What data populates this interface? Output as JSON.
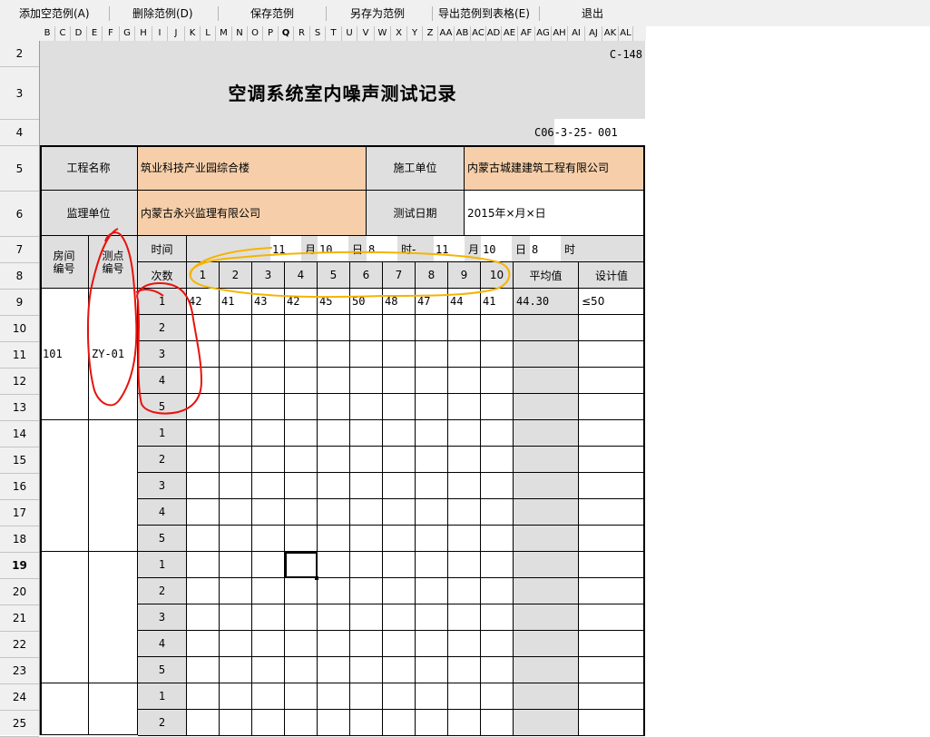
{
  "toolbar": {
    "add_empty": "添加空范例(A)",
    "delete": "删除范例(D)",
    "save": "保存范例",
    "save_as": "另存为范例",
    "export": "导出范例到表格(E)",
    "exit": "退出"
  },
  "columns": [
    "B",
    "C",
    "D",
    "E",
    "F",
    "G",
    "H",
    "I",
    "J",
    "K",
    "L",
    "M",
    "N",
    "O",
    "P",
    "Q",
    "R",
    "S",
    "T",
    "U",
    "V",
    "W",
    "X",
    "Y",
    "Z",
    "AA",
    "AB",
    "AC",
    "AD",
    "AE",
    "AF",
    "AG",
    "AH",
    "AI",
    "AJ",
    "AK",
    "AL"
  ],
  "selected_column": "Q",
  "rows": [
    "2",
    "3",
    "4",
    "5",
    "6",
    "7",
    "8",
    "9",
    "10",
    "11",
    "12",
    "13",
    "14",
    "15",
    "16",
    "17",
    "18",
    "19",
    "20",
    "21",
    "22",
    "23",
    "24",
    "25"
  ],
  "selected_row": "19",
  "form": {
    "code": "C-148",
    "title": "空调系统室内噪声测试记录",
    "record_no_prefix": "C06-3-25-",
    "record_no": "001",
    "project_name_label": "工程名称",
    "project_name": "筑业科技产业园综合楼",
    "contractor_label": "施工单位",
    "contractor": "内蒙古城建建筑工程有限公司",
    "supervisor_label": "监理单位",
    "supervisor": "内蒙古永兴监理有限公司",
    "test_date_label": "测试日期",
    "test_date": "2015年×月×日",
    "room_label": "房间编号",
    "point_label": "测点编号",
    "time_label": "时间",
    "count_label": "次数",
    "time_row": {
      "m1": "11",
      "month1_label": "月",
      "d1": "10",
      "day1_label": "日",
      "h1": "8",
      "hour1_label": "时-",
      "m2": "11",
      "month2_label": "月",
      "d2": "10",
      "day2_label": "日",
      "h2": "8",
      "hour2_label": "时"
    },
    "measure_headers": [
      "1",
      "2",
      "3",
      "4",
      "5",
      "6",
      "7",
      "8",
      "9",
      "10"
    ],
    "avg_label": "平均值",
    "design_label": "设计值",
    "groups": [
      {
        "room": "101",
        "point": "ZY-01"
      },
      {
        "room": "",
        "point": ""
      },
      {
        "room": "",
        "point": ""
      },
      {
        "room": "",
        "point": ""
      }
    ],
    "count_numbers": [
      "1",
      "2",
      "3",
      "4",
      "5"
    ],
    "first_row_values": [
      "42",
      "41",
      "43",
      "42",
      "45",
      "50",
      "48",
      "47",
      "44",
      "41"
    ],
    "first_row_avg": "44.30",
    "first_row_design": "≤50"
  },
  "colors": {
    "label_gray": "#dfdfdf",
    "peach": "#f6cfaa",
    "annot_red": "#e8120c",
    "annot_orange": "#f5b400"
  }
}
